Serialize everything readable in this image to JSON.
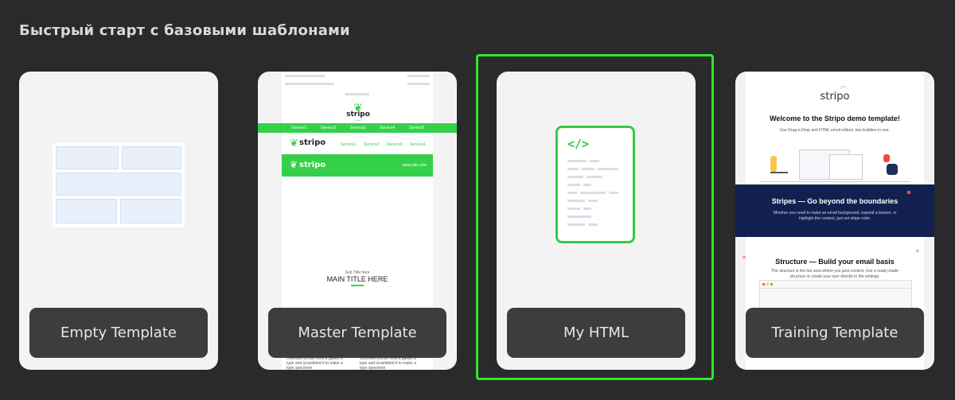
{
  "section_title": "Быстрый старт с базовыми шаблонами",
  "templates": [
    {
      "label": "Empty Template"
    },
    {
      "label": "Master Template"
    },
    {
      "label": "My HTML"
    },
    {
      "label": "Training Template"
    }
  ],
  "master_preview": {
    "logo": "stripo",
    "logo_sub": "email",
    "nav_items": [
      "Service1",
      "Service2",
      "Service3",
      "Service4",
      "Service5"
    ],
    "menu_items": [
      "Service1",
      "Service2",
      "Service3",
      "Service4"
    ],
    "banner_link": "www.site.com",
    "subtitle": "Sub Title here",
    "main_title": "MAIN TITLE HERE",
    "footer_text_1": "Unknown printer took a galley of type and scrambled it to make a type specimen",
    "footer_text_2": "Unknown printer took a galley of type and scrambled it to make a type specimen"
  },
  "my_html_preview": {
    "code_glyph": "</>"
  },
  "training_preview": {
    "logo": "stripo",
    "welcome_title": "Welcome to the Stripo demo template!",
    "welcome_text": "Use Drag-n-Drop and HTML email editors: two builders in one.",
    "stripes_title": "Stripes — Go beyond the boundaries",
    "stripes_text": "Whether you need to make an email background, expand a banner, or highlight the content, just set stripe color.",
    "structure_title": "Structure — Build your email basis",
    "structure_text": "The structure is the bar area where you post content. Use a ready-made structure or create your own directly in the settings."
  },
  "colors": {
    "background": "#2a2a2a",
    "card": "#f3f3f3",
    "label_bg": "#3d3d3d",
    "accent_green": "#2ee82e",
    "dark_navy": "#122050"
  }
}
